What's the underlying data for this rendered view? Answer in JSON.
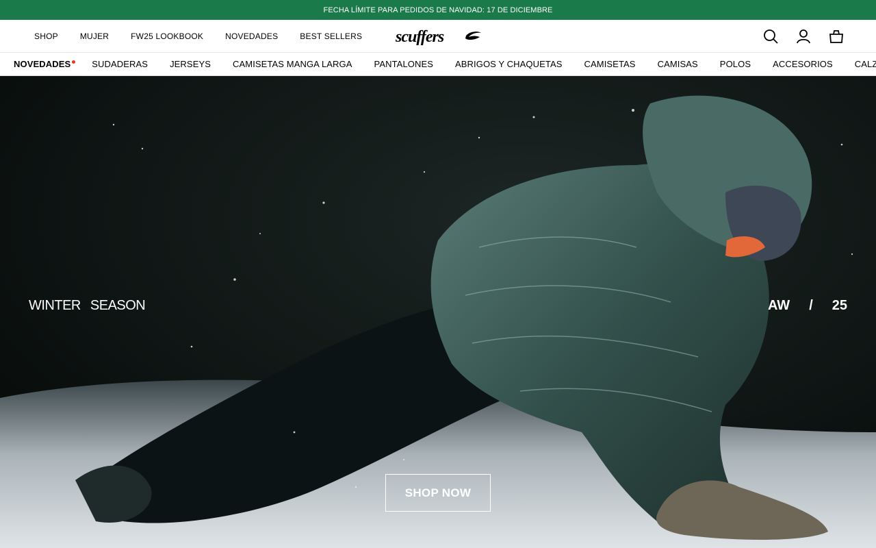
{
  "announcement": "FECHA LÍMITE PARA PEDIDOS DE NAVIDAD: 17 DE DICIEMBRE",
  "header": {
    "nav": [
      "SHOP",
      "MUJER",
      "FW25 LOOKBOOK",
      "NOVEDADES",
      "BEST SELLERS"
    ],
    "logo_text": "scuffers",
    "icons": [
      "search-icon",
      "user-icon",
      "bag-icon"
    ]
  },
  "categories": {
    "active": "NOVEDADES",
    "items": [
      "SUDADERAS",
      "JERSEYS",
      "CAMISETAS MANGA LARGA",
      "PANTALONES",
      "ABRIGOS Y CHAQUETAS",
      "CAMISETAS",
      "CAMISAS",
      "POLOS",
      "ACCESORIOS",
      "CALZADO"
    ],
    "dot_color": "#e63a1e"
  },
  "hero": {
    "left_words": [
      "WINTER",
      "SEASON"
    ],
    "right_words": [
      "AW",
      "/",
      "25"
    ],
    "cta": "SHOP NOW"
  },
  "colors": {
    "announcement_bg": "#1a7a4a",
    "jacket": "#3c5e58",
    "snow": "#cfd5d8"
  }
}
